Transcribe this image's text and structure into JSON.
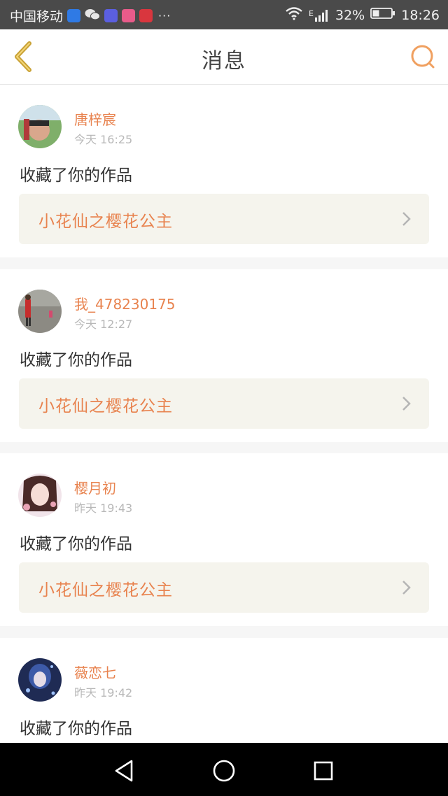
{
  "status_bar": {
    "carrier": "中国移动",
    "network": "E",
    "battery": "32%",
    "time": "18:26",
    "more": "···"
  },
  "header": {
    "title": "消息",
    "back_icon": "chevron-left-icon",
    "search_icon": "search-icon"
  },
  "colors": {
    "accent": "#e8834f",
    "back_icon": "#c9a236",
    "card_highlight": "#f5f4ed"
  },
  "messages": [
    {
      "user": "唐梓宸",
      "time": "今天 16:25",
      "action": "收藏了你的作品",
      "work": "小花仙之樱花公主"
    },
    {
      "user": "我_478230175",
      "time": "今天 12:27",
      "action": "收藏了你的作品",
      "work": "小花仙之樱花公主"
    },
    {
      "user": "樱月初",
      "time": "昨天 19:43",
      "action": "收藏了你的作品",
      "work": "小花仙之樱花公主"
    },
    {
      "user": "薇恋七",
      "time": "昨天 19:42",
      "action": "收藏了你的作品",
      "work": ""
    }
  ],
  "nav_bar": {
    "back_icon": "triangle-back-icon",
    "home_icon": "circle-home-icon",
    "recents_icon": "square-recents-icon"
  }
}
